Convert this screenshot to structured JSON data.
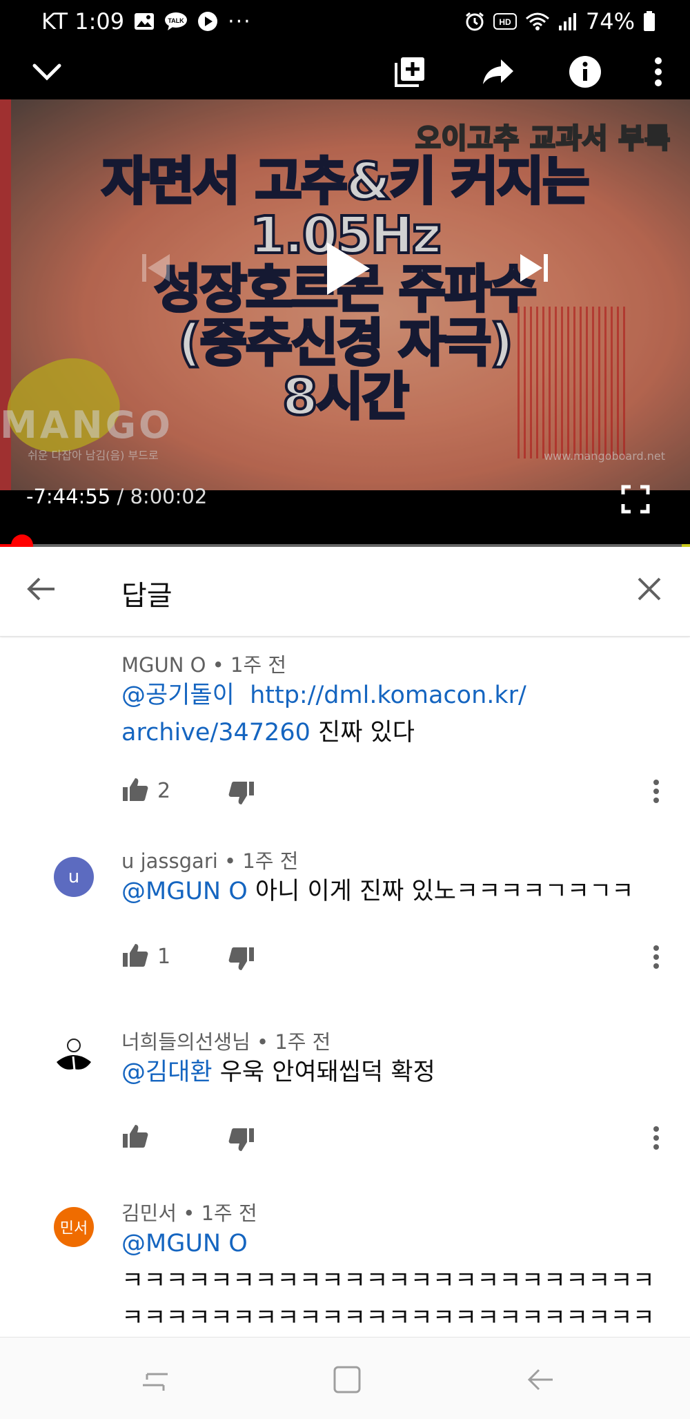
{
  "status_bar": {
    "carrier_time": "KT 1:09",
    "more": "···",
    "battery": "74%",
    "icons": [
      "gallery-icon",
      "talk-icon",
      "play-circle-icon",
      "alarm-icon",
      "hd-icon",
      "wifi-icon",
      "signal-icon",
      "battery-icon"
    ],
    "hd_label": "HD",
    "talk_label": "TALK"
  },
  "player": {
    "thumbnail": {
      "tag": "오이고추 교과서 부록",
      "title_lines": [
        "자면서 고추&키 커지는",
        "1.05Hz",
        "성장호르몬 주파수",
        "(중추신경 자극)",
        "8시간"
      ],
      "watermark": "MANGO",
      "small_left": "쉬운 다잡아 남김(음) 부드로",
      "small_right": "www.mangoboard.net"
    },
    "time_remaining": "-7:44:55",
    "time_separator": "/",
    "time_total": "8:00:02",
    "progress_fraction": 0.032,
    "accent_color": "#ff0000"
  },
  "replies_header": {
    "title": "답글"
  },
  "comments": [
    {
      "author": "MGUN O",
      "time": "1주 전",
      "mention": "@공기돌이",
      "link": "http://dml.komacon.kr/archive/347260",
      "link_line1": "http://dml.komacon.kr/",
      "link_line2": "archive/347260",
      "text": " 진짜 있다",
      "likes": "2",
      "avatar": ""
    },
    {
      "author": "u jassgari",
      "time": "1주 전",
      "mention": "@MGUN O",
      "text": " 아니 이게 진짜 있노ㅋㅋㅋㅋㄱㅋㄱㅋ",
      "likes": "1",
      "avatar": "u",
      "avatar_color": "#5c6bc0"
    },
    {
      "author": "너희들의선생님",
      "time": "1주 전",
      "mention": "@김대환",
      "text": " 우욱 안여돼씹덕 확정",
      "likes": "",
      "avatar": ""
    },
    {
      "author": "김민서",
      "time": "1주 전",
      "mention": "@MGUN O",
      "text_line1": "ㅋㅋㅋㅋㅋㅋㅋㅋㅋㅋㅋㅋㅋㅋㅋㅋㅋㅋㅋㅋㅋㅋㅋㅋ",
      "text_line2": "ㅋㅋㅋㅋㅋㅋㅋㅋㅋㅋㅋㅋㅋㅋㅋㅋㅋㅋㅋㅋㅋㅋㅋㅋ",
      "avatar": "민서",
      "avatar_color": "#ef6c00"
    }
  ],
  "meta_separator": " • ",
  "nav_bar": {
    "buttons": [
      "recent-apps-icon",
      "home-icon",
      "back-icon"
    ]
  }
}
